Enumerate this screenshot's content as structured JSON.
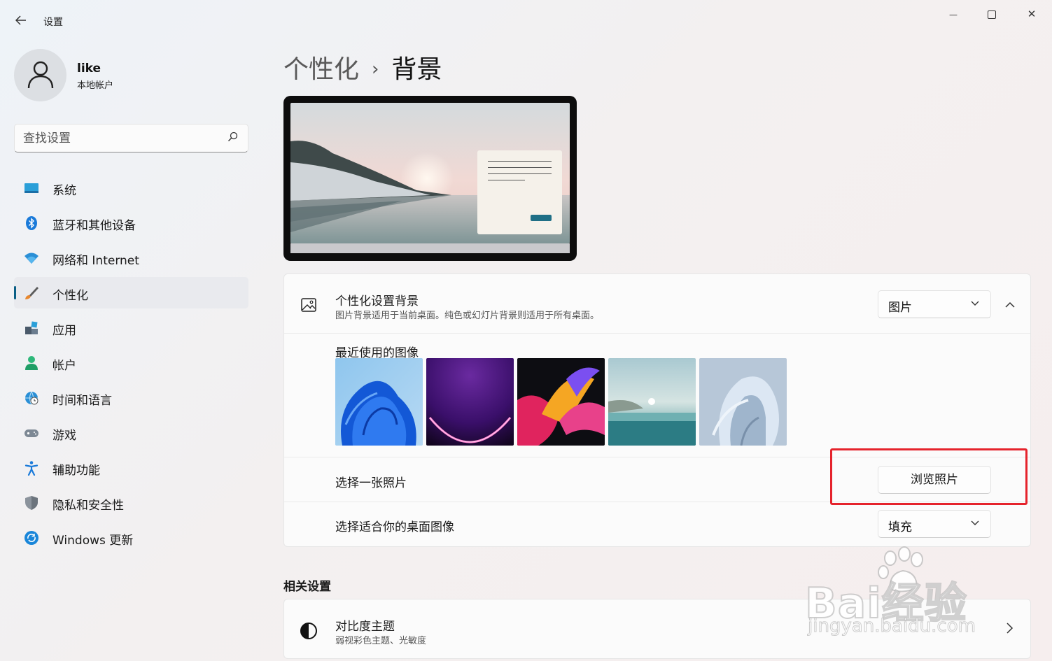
{
  "window": {
    "title": "设置",
    "controls": {
      "minimize": "—",
      "close": "✕"
    }
  },
  "user": {
    "name": "like",
    "account_type": "本地帐户"
  },
  "search": {
    "placeholder": "查找设置"
  },
  "sidebar": {
    "items": [
      {
        "label": "系统",
        "icon": "system-icon"
      },
      {
        "label": "蓝牙和其他设备",
        "icon": "bluetooth-icon"
      },
      {
        "label": "网络和 Internet",
        "icon": "wifi-icon"
      },
      {
        "label": "个性化",
        "icon": "brush-icon",
        "active": true
      },
      {
        "label": "应用",
        "icon": "apps-icon"
      },
      {
        "label": "帐户",
        "icon": "account-icon"
      },
      {
        "label": "时间和语言",
        "icon": "globe-clock-icon"
      },
      {
        "label": "游戏",
        "icon": "gamepad-icon"
      },
      {
        "label": "辅助功能",
        "icon": "accessibility-icon"
      },
      {
        "label": "隐私和安全性",
        "icon": "shield-icon"
      },
      {
        "label": "Windows 更新",
        "icon": "update-icon"
      }
    ]
  },
  "breadcrumb": {
    "parent": "个性化",
    "separator": "›",
    "current": "背景"
  },
  "background": {
    "title": "个性化设置背景",
    "subtitle": "图片背景适用于当前桌面。纯色或幻灯片背景则适用于所有桌面。",
    "type_selected": "图片",
    "recent_label": "最近使用的图像",
    "recent_images": [
      "bloom-blue",
      "glow-purple",
      "ribbon-colorful",
      "lake-sunrise",
      "bloom-silver"
    ],
    "choose_label": "选择一张照片",
    "browse_button": "浏览照片",
    "fit_label": "选择适合你的桌面图像",
    "fit_selected": "填充"
  },
  "related": {
    "title": "相关设置",
    "contrast": {
      "title": "对比度主题",
      "subtitle": "弱视彩色主题、光敏度"
    }
  },
  "watermark": {
    "brand": "Bai经验",
    "url": "jingyan.baidu.com"
  },
  "colors": {
    "accent": "#0a5f86",
    "highlight": "#e5232c"
  }
}
